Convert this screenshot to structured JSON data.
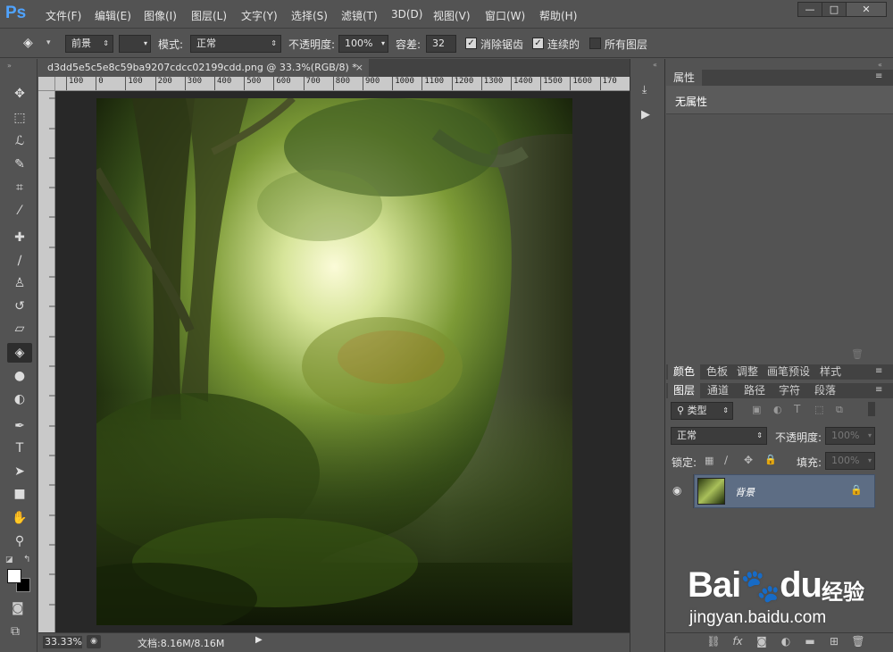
{
  "app": {
    "logo": "Ps",
    "menu": [
      "文件(F)",
      "编辑(E)",
      "图像(I)",
      "图层(L)",
      "文字(Y)",
      "选择(S)",
      "滤镜(T)",
      "3D(D)",
      "视图(V)",
      "窗口(W)",
      "帮助(H)"
    ],
    "window_buttons": [
      "—",
      "□",
      "✕"
    ]
  },
  "options": {
    "fill_source": "前景",
    "mode_label": "模式:",
    "mode_value": "正常",
    "opacity_label": "不透明度:",
    "opacity_value": "100%",
    "tolerance_label": "容差:",
    "tolerance_value": "32",
    "antialias_label": "消除锯齿",
    "antialias_checked": true,
    "contiguous_label": "连续的",
    "contiguous_checked": true,
    "all_layers_label": "所有图层",
    "all_layers_checked": false
  },
  "document": {
    "tab_title": "d3dd5e5c5e8c59ba9207cdcc02199cdd.png @ 33.3%(RGB/8) *",
    "close_glyph": "×",
    "ruler_ticks": [
      "100",
      "0",
      "100",
      "200",
      "300",
      "400",
      "500",
      "600",
      "700",
      "800",
      "900",
      "1000",
      "1100",
      "1200",
      "1300",
      "1400",
      "1500",
      "1600",
      "170"
    ]
  },
  "status": {
    "zoom": "33.33%",
    "doc_info": "文档:8.16M/8.16M"
  },
  "tools": [
    {
      "name": "move-tool-icon",
      "glyph": "✥"
    },
    {
      "name": "marquee-tool-icon",
      "glyph": "⬚"
    },
    {
      "name": "lasso-tool-icon",
      "glyph": "ℒ"
    },
    {
      "name": "quick-select-tool-icon",
      "glyph": "✎"
    },
    {
      "name": "crop-tool-icon",
      "glyph": "⌗"
    },
    {
      "name": "eyedropper-tool-icon",
      "glyph": "⁄"
    },
    {
      "name": "healing-brush-tool-icon",
      "glyph": "✚"
    },
    {
      "name": "brush-tool-icon",
      "glyph": "∕"
    },
    {
      "name": "clone-stamp-tool-icon",
      "glyph": "♙"
    },
    {
      "name": "history-brush-tool-icon",
      "glyph": "↺"
    },
    {
      "name": "eraser-tool-icon",
      "glyph": "▱"
    },
    {
      "name": "paint-bucket-tool-icon",
      "glyph": "◈"
    },
    {
      "name": "blur-tool-icon",
      "glyph": "●"
    },
    {
      "name": "dodge-tool-icon",
      "glyph": "◐"
    },
    {
      "name": "pen-tool-icon",
      "glyph": "✒"
    },
    {
      "name": "type-tool-icon",
      "glyph": "T"
    },
    {
      "name": "path-select-tool-icon",
      "glyph": "➤"
    },
    {
      "name": "rectangle-tool-icon",
      "glyph": "■"
    },
    {
      "name": "hand-tool-icon",
      "glyph": "✋"
    },
    {
      "name": "zoom-tool-icon",
      "glyph": "⚲"
    }
  ],
  "properties": {
    "tab": "属性",
    "content": "无属性"
  },
  "panels_row1": [
    "颜色",
    "色板",
    "调整",
    "画笔预设",
    "样式"
  ],
  "panels_row2": [
    "图层",
    "通道",
    "路径",
    "字符",
    "段落"
  ],
  "layers": {
    "filter_kind": "类型",
    "blend_mode": "正常",
    "opacity_label": "不透明度:",
    "opacity_value": "100%",
    "lock_label": "锁定:",
    "fill_label": "填充:",
    "fill_value": "100%",
    "layer_name": "背景"
  },
  "watermark": {
    "brand": "Bai",
    "brand2": "du",
    "cn": "经验",
    "url": "jingyan.baidu.com"
  },
  "colors": {
    "ui_bg": "#535353",
    "canvas_bg": "#282828",
    "selected_layer": "#5d6d84",
    "logo_blue": "#4fa3ff"
  }
}
